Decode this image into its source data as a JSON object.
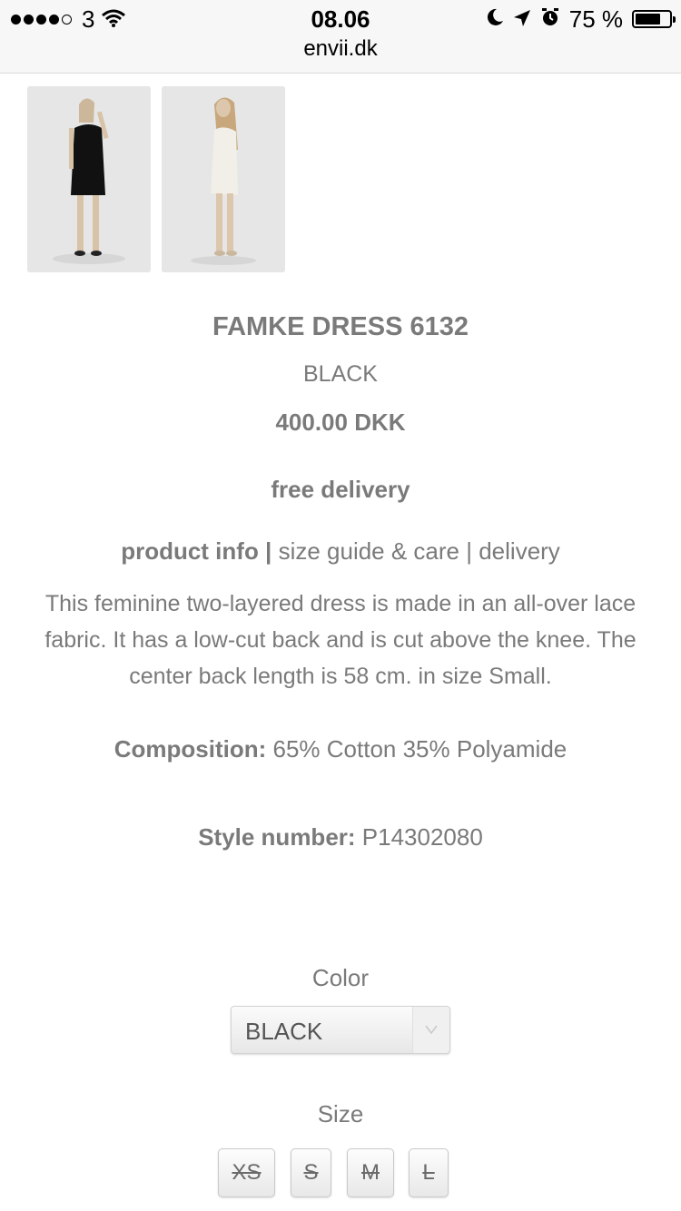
{
  "status": {
    "carrier": "3",
    "time": "08.06",
    "battery_text": "75 %",
    "battery_level": 0.75,
    "url": "envii.dk"
  },
  "product": {
    "title": "FAMKE DRESS 6132",
    "color": "BLACK",
    "price": "400.00 DKK",
    "delivery_note": "free delivery",
    "tabs": {
      "info": "product info",
      "sep1": " | ",
      "size": "size guide & care",
      "sep2": " | ",
      "delivery": "delivery"
    },
    "description": "This feminine two-layered dress is made in an all-over lace fabric. It has a low-cut back and is cut above the knee. The center back length is 58 cm. in size Small.",
    "composition_label": "Composition:",
    "composition_value": " 65% Cotton 35% Polyamide",
    "style_label": "Style number:",
    "style_value": " P14302080"
  },
  "options": {
    "color_label": "Color",
    "color_selected": "BLACK",
    "size_label": "Size",
    "sizes": [
      "XS",
      "S",
      "M",
      "L"
    ]
  },
  "colors": {
    "text_gray": "#7a7a7a",
    "dress_black": "#111111",
    "dress_white": "#f2efe8"
  }
}
